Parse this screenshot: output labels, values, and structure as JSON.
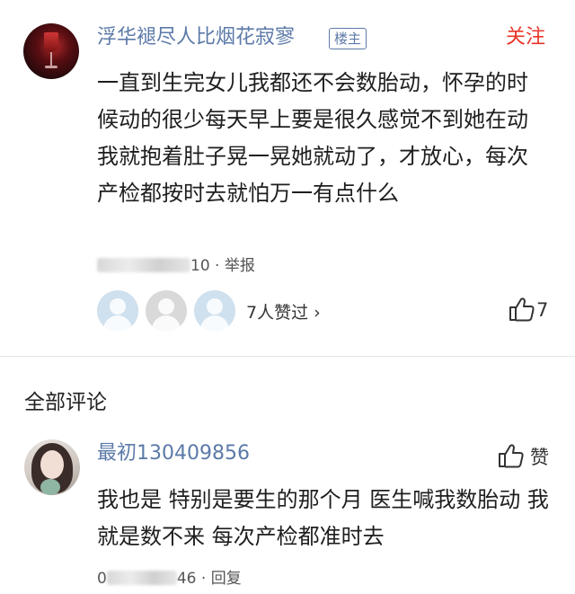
{
  "post": {
    "username": "浮华褪尽人比烟花寂寥",
    "badge": "楼主",
    "follow_label": "关注",
    "body": "一直到生完女儿我都还不会数胎动，怀孕的时候动的很少每天早上要是很久感觉不到她在动我就抱着肚子晃一晃她就动了，才放心，每次产检都按时去就怕万一有点什么",
    "meta_tail": "10",
    "meta_sep": "·",
    "report_label": "举报",
    "likers_text": "7人赞过 ›",
    "like_count": "7",
    "avatar_icon": "wine-glass-avatar"
  },
  "comments": {
    "section_title": "全部评论",
    "items": [
      {
        "username": "最初130409856",
        "like_label": "赞",
        "body": "我也是 特别是要生的那个月 医生喊我数胎动 我就是数不来 每次产检都准时去",
        "meta_head": "0",
        "meta_tail": "46",
        "meta_sep": "·",
        "reply_label": "回复"
      }
    ]
  },
  "colors": {
    "username": "#5c7aa8",
    "follow": "#e8362a",
    "divider": "#e6e6e6",
    "meta": "#555555"
  }
}
